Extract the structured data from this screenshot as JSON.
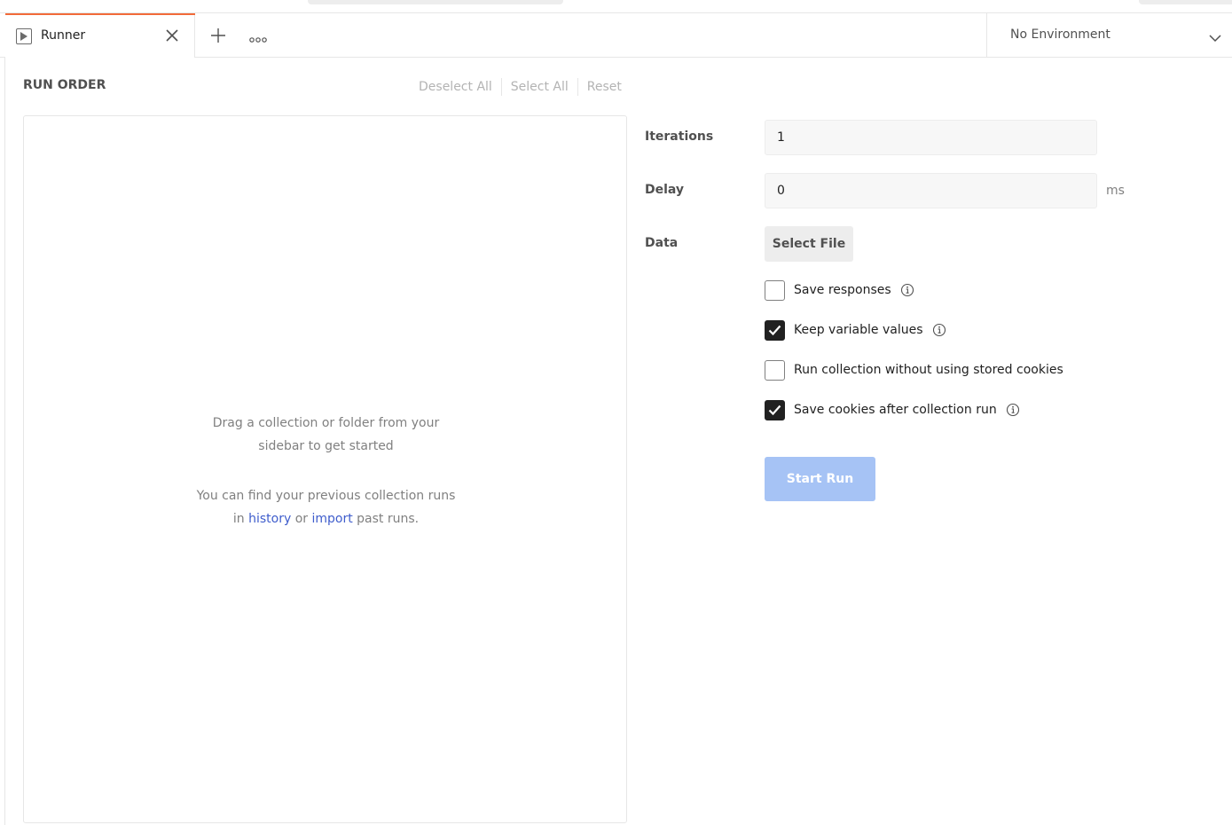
{
  "tabs": {
    "active_label": "Runner"
  },
  "environment": {
    "selected": "No Environment"
  },
  "run_order": {
    "title": "RUN ORDER",
    "deselect_all": "Deselect All",
    "select_all": "Select All",
    "reset": "Reset",
    "empty_line1": "Drag a collection or folder from your",
    "empty_line2": "sidebar to get started",
    "hint_prefix_1": "You can find your previous collection runs",
    "hint_prefix_2": "in",
    "history_link": "history",
    "hint_or": "or",
    "import_link": "import",
    "hint_suffix": "past runs."
  },
  "settings": {
    "iterations_label": "Iterations",
    "iterations_value": "1",
    "delay_label": "Delay",
    "delay_value": "0",
    "delay_unit": "ms",
    "data_label": "Data",
    "select_file": "Select File",
    "options": [
      {
        "label": "Save responses",
        "checked": false,
        "info": true
      },
      {
        "label": "Keep variable values",
        "checked": true,
        "info": true
      },
      {
        "label": "Run collection without using stored cookies",
        "checked": false,
        "info": false
      },
      {
        "label": "Save cookies after collection run",
        "checked": true,
        "info": true
      }
    ],
    "start_run": "Start Run"
  },
  "colors": {
    "accent_tab": "#f26b3a",
    "link": "#3f5dcc",
    "start_run_disabled": "#a6c3f5"
  }
}
